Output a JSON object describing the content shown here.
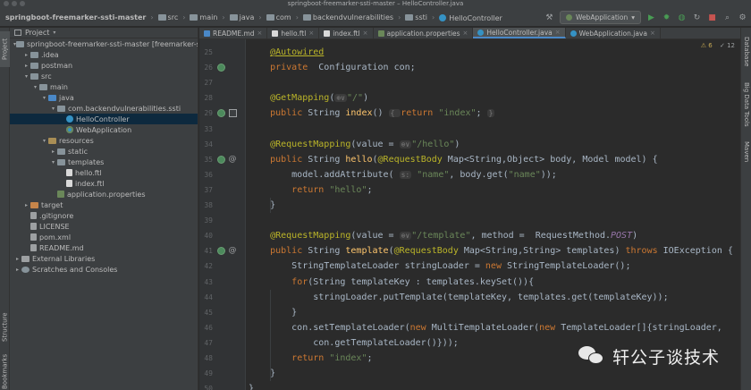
{
  "window": {
    "title": "springboot-freemarker-ssti-master – HelloController.java"
  },
  "breadcrumb": [
    "springboot-freemarker-ssti-master",
    "src",
    "main",
    "java",
    "com",
    "backendvulnerabilities",
    "ssti",
    "HelloController"
  ],
  "run_config": {
    "label": "WebApplication"
  },
  "left_strip": {
    "project": "Project",
    "structure": "Structure",
    "bookmarks": "Bookmarks"
  },
  "right_strip": {
    "database": "Database",
    "bigdata": "Big Data Tools",
    "maven": "Maven"
  },
  "project_panel": {
    "title": "Project",
    "tree": [
      {
        "label": "springboot-freemarker-ssti-master [freemarker-ssti]",
        "depth": 0,
        "arrow": "▾",
        "icon": "folder"
      },
      {
        "label": ".idea",
        "depth": 1,
        "arrow": "▸",
        "icon": "folder"
      },
      {
        "label": "postman",
        "depth": 1,
        "arrow": "▸",
        "icon": "folder"
      },
      {
        "label": "src",
        "depth": 1,
        "arrow": "▾",
        "icon": "folder"
      },
      {
        "label": "main",
        "depth": 2,
        "arrow": "▾",
        "icon": "folder"
      },
      {
        "label": "java",
        "depth": 3,
        "arrow": "▾",
        "icon": "folder-blue"
      },
      {
        "label": "com.backendvulnerabilities.ssti",
        "depth": 4,
        "arrow": "▾",
        "icon": "folder"
      },
      {
        "label": "HelloController",
        "depth": 5,
        "arrow": "",
        "icon": "class",
        "selected": true
      },
      {
        "label": "WebApplication",
        "depth": 5,
        "arrow": "",
        "icon": "springclass"
      },
      {
        "label": "resources",
        "depth": 3,
        "arrow": "▾",
        "icon": "folder-res"
      },
      {
        "label": "static",
        "depth": 4,
        "arrow": "▸",
        "icon": "folder"
      },
      {
        "label": "templates",
        "depth": 4,
        "arrow": "▾",
        "icon": "folder"
      },
      {
        "label": "hello.ftl",
        "depth": 5,
        "arrow": "",
        "icon": "ftl"
      },
      {
        "label": "index.ftl",
        "depth": 5,
        "arrow": "",
        "icon": "ftl"
      },
      {
        "label": "application.properties",
        "depth": 4,
        "arrow": "",
        "icon": "props"
      },
      {
        "label": "target",
        "depth": 1,
        "arrow": "▸",
        "icon": "folder-target"
      },
      {
        "label": ".gitignore",
        "depth": 1,
        "arrow": "",
        "icon": "file"
      },
      {
        "label": "LICENSE",
        "depth": 1,
        "arrow": "",
        "icon": "file"
      },
      {
        "label": "pom.xml",
        "depth": 1,
        "arrow": "",
        "icon": "file"
      },
      {
        "label": "README.md",
        "depth": 1,
        "arrow": "",
        "icon": "file"
      },
      {
        "label": "External Libraries",
        "depth": 0,
        "arrow": "▸",
        "icon": "lib"
      },
      {
        "label": "Scratches and Consoles",
        "depth": 0,
        "arrow": "▸",
        "icon": "scratch"
      }
    ]
  },
  "tabs": [
    {
      "label": "README.md",
      "icon": "md",
      "active": false
    },
    {
      "label": "hello.ftl",
      "icon": "ftl",
      "active": false
    },
    {
      "label": "index.ftl",
      "icon": "ftl",
      "active": false
    },
    {
      "label": "application.properties",
      "icon": "props",
      "active": false
    },
    {
      "label": "HelloController.java",
      "icon": "class",
      "active": true
    },
    {
      "label": "WebApplication.java",
      "icon": "class",
      "active": false
    }
  ],
  "inspections": {
    "warnings": "⚠ 6",
    "misc": "✓ 12"
  },
  "editor": {
    "lines": [
      {
        "n": "25",
        "tokens": [
          [
            "    ",
            ""
          ],
          [
            "@Autowired",
            "an ul"
          ]
        ]
      },
      {
        "n": "26",
        "tokens": [
          [
            "    ",
            ""
          ],
          [
            "private",
            "kw"
          ],
          [
            "  Configuration con;",
            ""
          ]
        ],
        "gicon": "bean"
      },
      {
        "n": "27",
        "tokens": []
      },
      {
        "n": "28",
        "tokens": [
          [
            "    ",
            ""
          ],
          [
            "@GetMapping",
            "an"
          ],
          [
            "(",
            ""
          ],
          [
            "⊕∨",
            "hint"
          ],
          [
            "\"/\"",
            "str"
          ],
          [
            ")",
            ""
          ]
        ]
      },
      {
        "n": "29",
        "tokens": [
          [
            "    ",
            ""
          ],
          [
            "public",
            "kw"
          ],
          [
            " String ",
            ""
          ],
          [
            "index",
            "fn"
          ],
          [
            "() ",
            ""
          ],
          [
            "{ ",
            "hint"
          ],
          [
            "return",
            "kw"
          ],
          [
            " ",
            ""
          ],
          [
            "\"index\"",
            "str"
          ],
          [
            "; ",
            ""
          ],
          [
            "}",
            "hint"
          ]
        ],
        "gicon": "bean",
        "gmark": true
      },
      {
        "n": "33",
        "tokens": []
      },
      {
        "n": "34",
        "tokens": [
          [
            "    ",
            ""
          ],
          [
            "@RequestMapping",
            "an"
          ],
          [
            "(value = ",
            ""
          ],
          [
            "⊕∨",
            "hint"
          ],
          [
            "\"/hello\"",
            "str"
          ],
          [
            ")",
            ""
          ]
        ]
      },
      {
        "n": "35",
        "tokens": [
          [
            "    ",
            ""
          ],
          [
            "public",
            "kw"
          ],
          [
            " String ",
            ""
          ],
          [
            "hello",
            "fn"
          ],
          [
            "(",
            ""
          ],
          [
            "@RequestBody",
            "an"
          ],
          [
            " Map<String,Object> body, Model model) {",
            ""
          ]
        ],
        "gicon": "bean",
        "at": true
      },
      {
        "n": "36",
        "tokens": [
          [
            "        model.addAttribute( ",
            ""
          ],
          [
            "s:",
            "hint"
          ],
          [
            " ",
            ""
          ],
          [
            "\"name\"",
            "str"
          ],
          [
            ", body.get(",
            ""
          ],
          [
            "\"name\"",
            "str"
          ],
          [
            "));",
            ""
          ]
        ]
      },
      {
        "n": "37",
        "tokens": [
          [
            "        ",
            ""
          ],
          [
            "return",
            "kw"
          ],
          [
            " ",
            ""
          ],
          [
            "\"hello\"",
            "str"
          ],
          [
            ";",
            ""
          ]
        ]
      },
      {
        "n": "38",
        "tokens": [
          [
            "    }",
            ""
          ]
        ]
      },
      {
        "n": "39",
        "tokens": []
      },
      {
        "n": "40",
        "tokens": [
          [
            "    ",
            ""
          ],
          [
            "@RequestMapping",
            "an"
          ],
          [
            "(value = ",
            ""
          ],
          [
            "⊕∨",
            "hint"
          ],
          [
            "\"/template\"",
            "str"
          ],
          [
            ", method =  RequestMethod.",
            ""
          ],
          [
            "POST",
            "it"
          ],
          [
            ")",
            ""
          ]
        ]
      },
      {
        "n": "41",
        "tokens": [
          [
            "    ",
            ""
          ],
          [
            "public",
            "kw"
          ],
          [
            " String ",
            ""
          ],
          [
            "template",
            "fn"
          ],
          [
            "(",
            ""
          ],
          [
            "@RequestBody",
            "an"
          ],
          [
            " Map<String,String> templates) ",
            ""
          ],
          [
            "throws",
            "kw"
          ],
          [
            " IOException {",
            ""
          ]
        ],
        "gicon": "bean",
        "at": true
      },
      {
        "n": "42",
        "tokens": [
          [
            "        StringTemplateLoader stringLoader = ",
            ""
          ],
          [
            "new",
            "kw"
          ],
          [
            " StringTemplateLoader();",
            ""
          ]
        ]
      },
      {
        "n": "43",
        "tokens": [
          [
            "        ",
            ""
          ],
          [
            "for",
            "kw"
          ],
          [
            "(String templateKey : templates.keySet()){",
            ""
          ]
        ]
      },
      {
        "n": "44",
        "tokens": [
          [
            "            stringLoader.putTemplate(templateKey, templates.get(templateKey));",
            ""
          ]
        ]
      },
      {
        "n": "45",
        "tokens": [
          [
            "        }",
            ""
          ]
        ]
      },
      {
        "n": "46",
        "tokens": [
          [
            "        con.setTemplateLoader(",
            ""
          ],
          [
            "new",
            "kw"
          ],
          [
            " MultiTemplateLoader(",
            ""
          ],
          [
            "new",
            "kw"
          ],
          [
            " TemplateLoader[]{stringLoader,",
            ""
          ]
        ]
      },
      {
        "n": "47",
        "tokens": [
          [
            "            con.getTemplateLoader()}));",
            ""
          ]
        ]
      },
      {
        "n": "48",
        "tokens": [
          [
            "        ",
            ""
          ],
          [
            "return",
            "kw"
          ],
          [
            " ",
            ""
          ],
          [
            "\"index\"",
            "str"
          ],
          [
            ";",
            ""
          ]
        ]
      },
      {
        "n": "49",
        "tokens": [
          [
            "    }",
            ""
          ]
        ]
      },
      {
        "n": "50",
        "tokens": [
          [
            "}",
            ""
          ]
        ]
      }
    ]
  },
  "watermark": {
    "text": "轩公子谈技术"
  }
}
